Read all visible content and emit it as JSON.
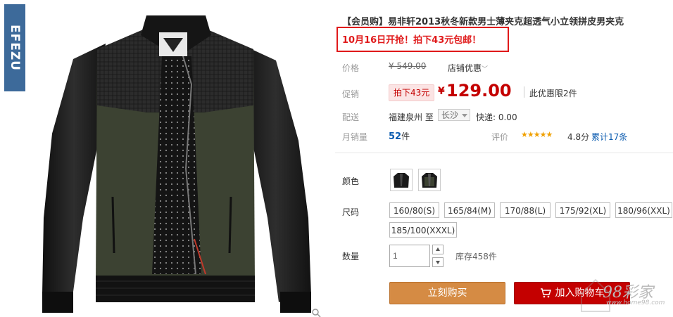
{
  "brand": {
    "logo_text": "EFEZU"
  },
  "product": {
    "title": "【会员购】易非轩2013秋冬新款男士薄夹克超透气小立领拼皮男夹克",
    "promo_text": "10月16日开抢！拍下43元包邮！",
    "price_label": "价格",
    "original_price": "¥ 549.00",
    "shop_discount": "店铺优惠",
    "promo_label": "促销",
    "promo_tag": "拍下43元",
    "currency": "¥",
    "sale_price": "129.00",
    "limit_text": "此优惠限2件",
    "ship_label": "配送",
    "ship_from": "福建泉州 至",
    "ship_to": "长沙",
    "ship_fee": "快递: 0.00",
    "sales_label": "月销量",
    "sales_count": "52",
    "sales_unit": "件",
    "rating_label": "评价",
    "rating_stars": "★★★★★",
    "rating_score": "4.8分",
    "review_link": "累计17条",
    "color_label": "颜色",
    "size_label": "尺码",
    "sizes": [
      "160/80(S)",
      "165/84(M)",
      "170/88(L)",
      "175/92(XL)",
      "180/96(XXL)",
      "185/100(XXXL)"
    ],
    "qty_label": "数量",
    "qty_value": "1",
    "stock_text": "库存458件",
    "buy_now": "立刻购买",
    "add_to_cart": "加入购物车"
  },
  "watermark": {
    "text": "98彩家",
    "url": "www.home98.com"
  },
  "colors": {
    "price_red": "#c40000",
    "promo_red": "#e0191a",
    "buy_orange": "#d58b44",
    "link_blue": "#0a5bb0",
    "brand_blue": "#3d6a9a"
  }
}
